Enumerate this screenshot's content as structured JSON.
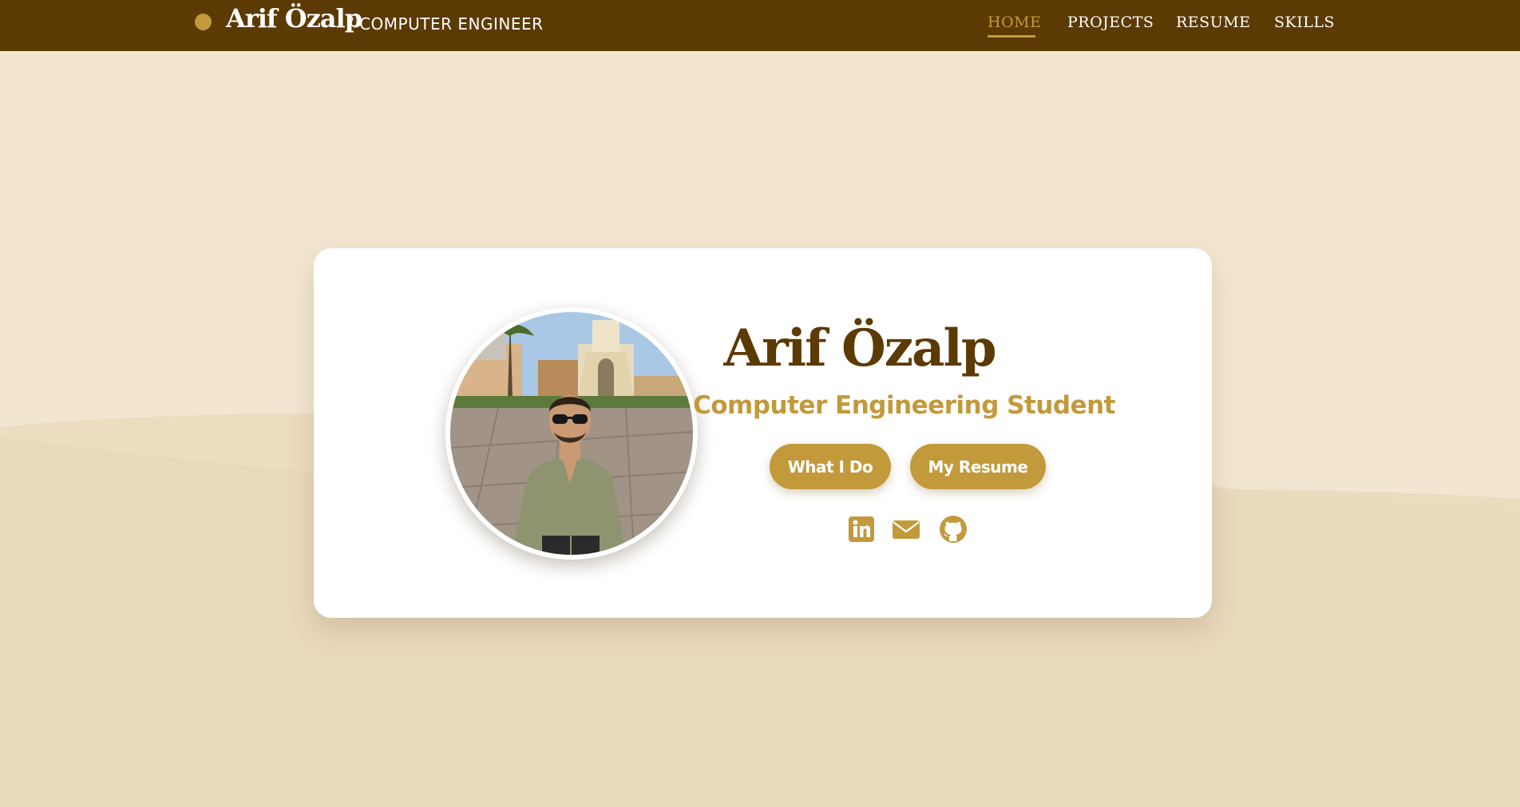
{
  "navbar": {
    "brand_name": "Arif Özalp",
    "brand_subtitle": "/ COMPUTER ENGINEER",
    "items": [
      {
        "label": "HOME",
        "active": true
      },
      {
        "label": "PROJECTS",
        "active": false
      },
      {
        "label": "RESUME",
        "active": false
      },
      {
        "label": "SKILLS",
        "active": false
      }
    ]
  },
  "profile": {
    "name": "Arif Özalp",
    "title": "Computer Engineering Student",
    "buttons": {
      "what_i_do": "What I Do",
      "my_resume": "My Resume"
    },
    "social_icons": [
      "linkedin-icon",
      "mail-icon",
      "github-icon"
    ]
  },
  "colors": {
    "navbar_bg": "#5c3a03",
    "accent_gold": "#c29a3c",
    "page_bg": "#f3e6d1",
    "card_bg": "#ffffff",
    "name_color": "#5c3a03"
  }
}
